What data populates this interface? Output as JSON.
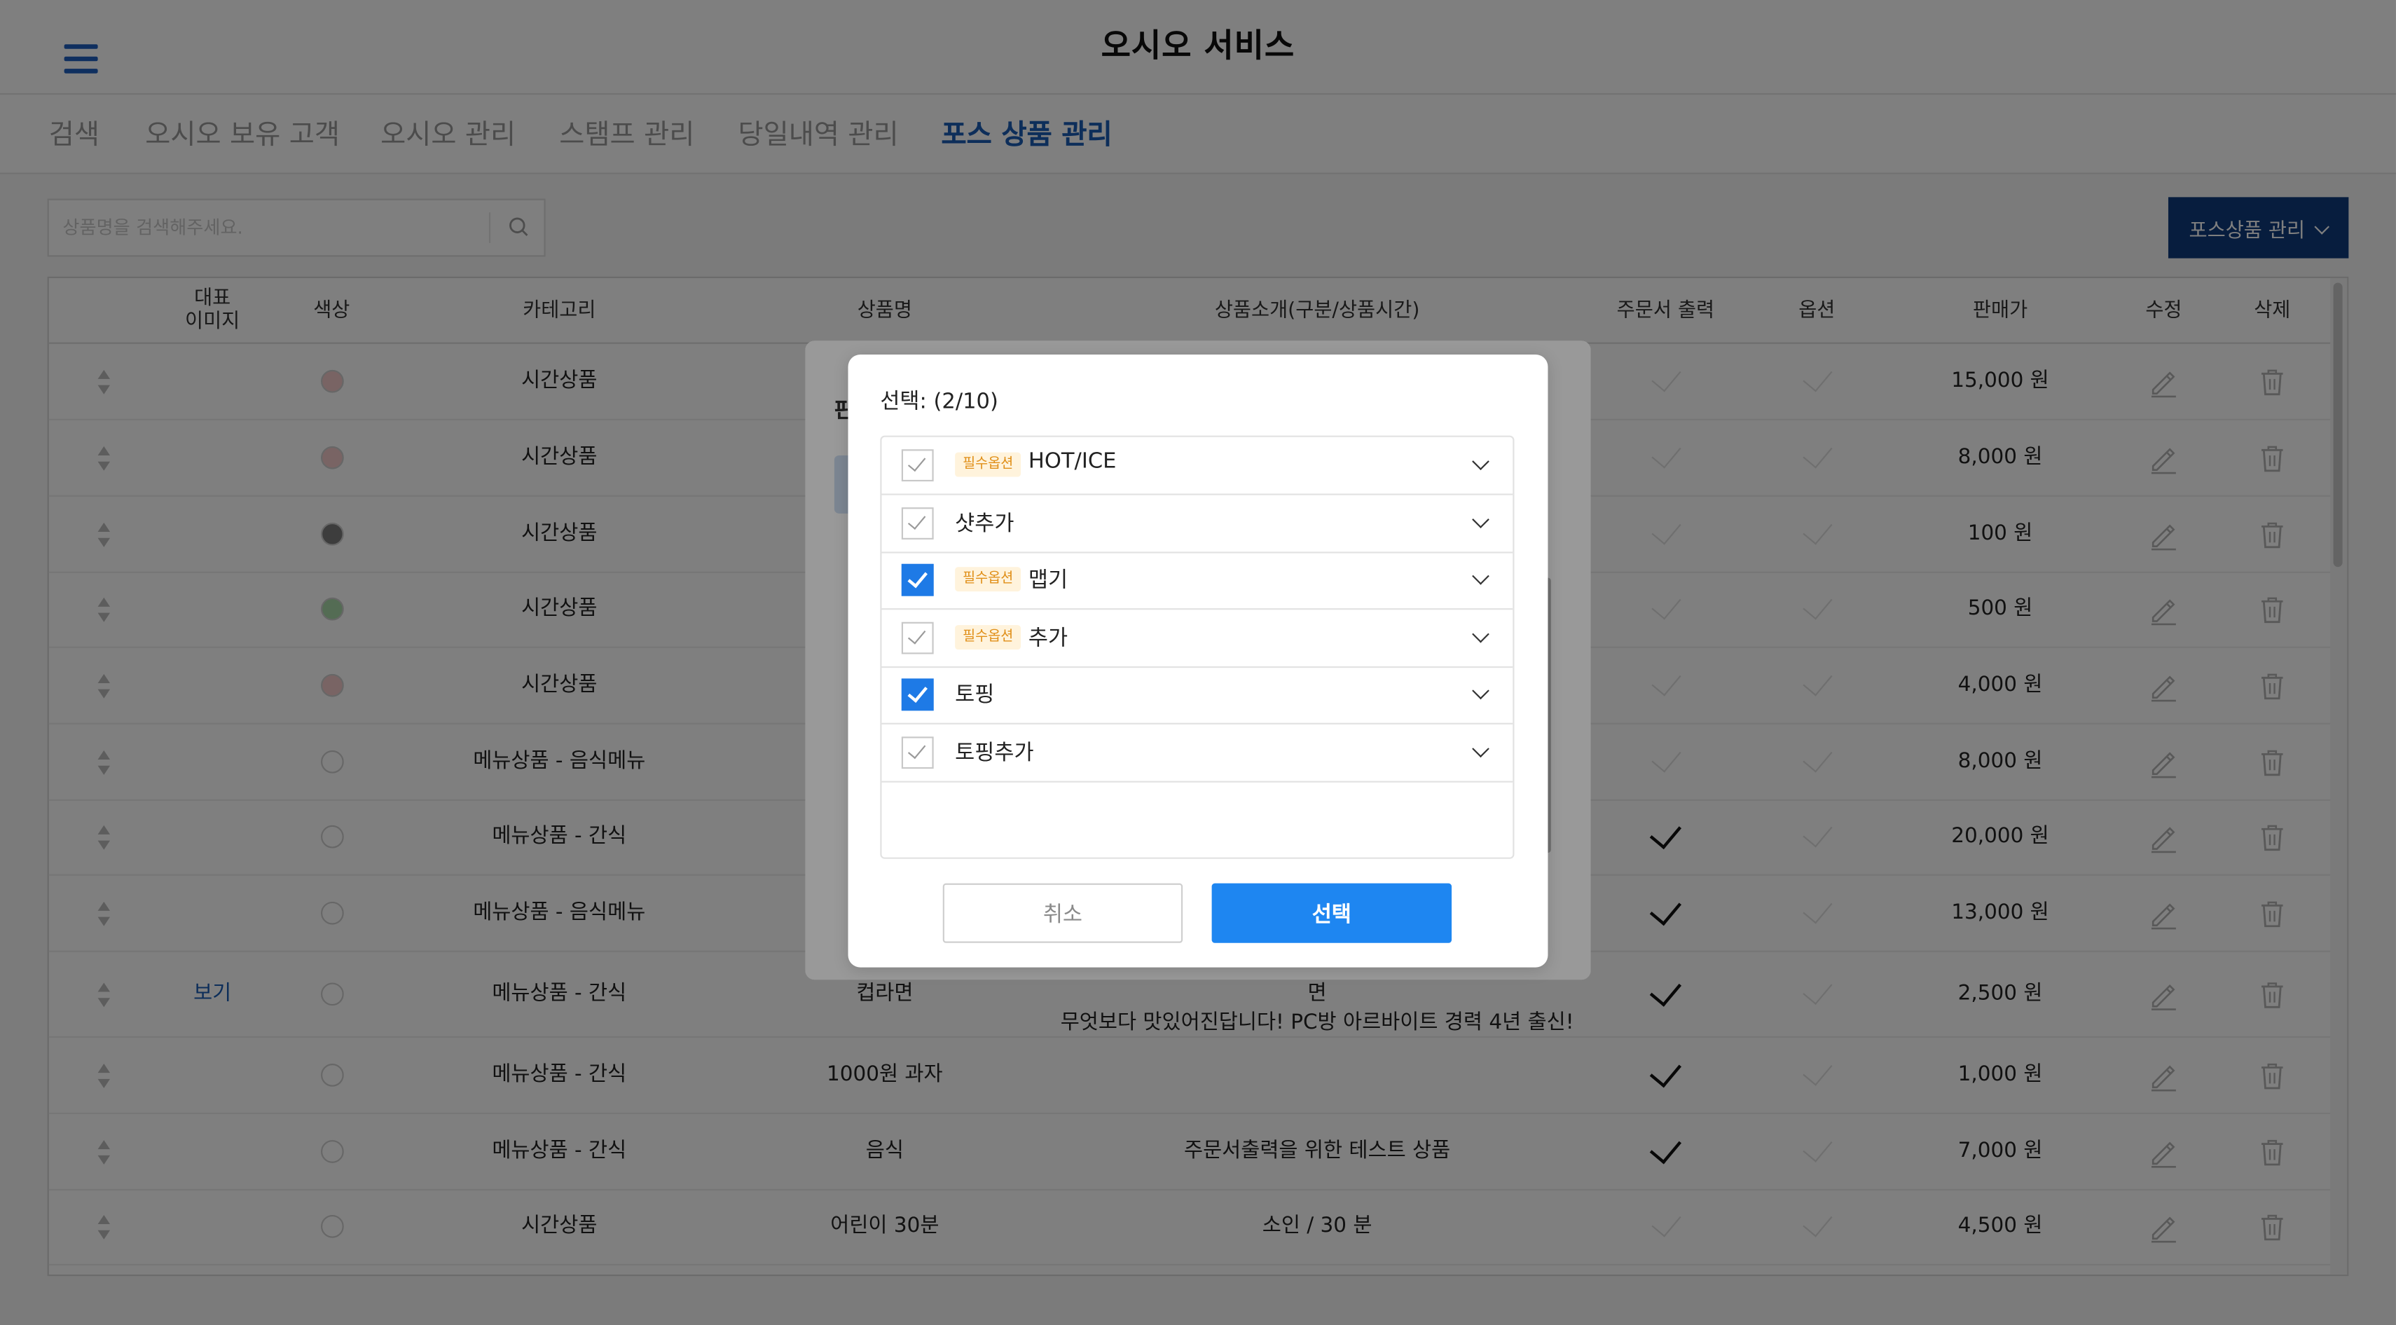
{
  "header": {
    "title": "오시오 서비스",
    "menu_icon": "hamburger-icon"
  },
  "tabs": [
    {
      "label": "검색"
    },
    {
      "label": "오시오 보유 고객"
    },
    {
      "label": "오시오 관리"
    },
    {
      "label": "스탬프 관리"
    },
    {
      "label": "당일내역 관리"
    },
    {
      "label": "포스 상품 관리",
      "active": true
    }
  ],
  "toolbar": {
    "search_placeholder": "상품명을 검색해주세요.",
    "search_icon": "search-icon",
    "pos_button_label": "포스상품 관리"
  },
  "table": {
    "columns": {
      "image_line1": "대표",
      "image_line2": "이미지",
      "color": "색상",
      "category": "카테고리",
      "name": "상품명",
      "description": "상품소개(구분/상품시간)",
      "print": "주문서 출력",
      "option": "옵션",
      "price": "판매가",
      "edit": "수정",
      "delete": "삭제"
    },
    "rows": [
      {
        "image": "",
        "color": "#f2c9c9",
        "category": "시간상품",
        "name": "",
        "desc1": "",
        "desc2": "",
        "print": false,
        "price": "15,000 원"
      },
      {
        "image": "",
        "color": "#f2c9c9",
        "category": "시간상품",
        "name": "",
        "desc1": "",
        "desc2": "",
        "print": false,
        "price": "8,000 원"
      },
      {
        "image": "",
        "color": "#7b7b7b",
        "category": "시간상품",
        "name": "",
        "desc1": "",
        "desc2": "",
        "print": false,
        "price": "100 원"
      },
      {
        "image": "",
        "color": "#a8d8a8",
        "category": "시간상품",
        "name": "",
        "desc1": "",
        "desc2": "",
        "print": false,
        "price": "500 원"
      },
      {
        "image": "",
        "color": "#f2c9c9",
        "category": "시간상품",
        "name": "",
        "desc1": "",
        "desc2": "",
        "print": false,
        "price": "4,000 원"
      },
      {
        "image": "",
        "color": "#ffffff",
        "category": "메뉴상품 - 음식메뉴",
        "name": "",
        "desc1": "",
        "desc2": "",
        "print": false,
        "price": "8,000 원"
      },
      {
        "image": "",
        "color": "#ffffff",
        "category": "메뉴상품 - 간식",
        "name": "",
        "desc1": "",
        "desc2": "",
        "print": true,
        "price": "20,000 원"
      },
      {
        "image": "",
        "color": "#ffffff",
        "category": "메뉴상품 - 음식메뉴",
        "name": "",
        "desc1": "",
        "desc2": "",
        "print": true,
        "price": "13,000 원"
      },
      {
        "image": "보기",
        "color": "#ffffff",
        "category": "메뉴상품 - 간식",
        "name": "컵라면",
        "desc1": "너구리 참깨라면 불닭볶음면 무엇이든 전자레인지와 함께라면",
        "desc2": "무엇보다 맛있어진답니다! PC방 아르바이트 경력 4년 출신!",
        "print": true,
        "price": "2,500 원"
      },
      {
        "image": "",
        "color": "#ffffff",
        "category": "메뉴상품 - 간식",
        "name": "1000원 과자",
        "desc1": "",
        "desc2": "",
        "print": true,
        "price": "1,000 원"
      },
      {
        "image": "",
        "color": "#ffffff",
        "category": "메뉴상품 - 간식",
        "name": "음식",
        "desc1": "주문서출력을 위한 테스트 상품",
        "desc2": "",
        "print": true,
        "price": "7,000 원"
      },
      {
        "image": "",
        "color": "#ffffff",
        "category": "시간상품",
        "name": "어린이 30분",
        "desc1": "소인 / 30 분",
        "desc2": "",
        "print": false,
        "price": "4,500 원"
      }
    ]
  },
  "back_dialog": {
    "title_fragment": "판"
  },
  "modal": {
    "title": "선택: (2/10)",
    "badge_label": "필수옵션",
    "options": [
      {
        "label": "HOT/ICE",
        "required": true,
        "checked": false
      },
      {
        "label": "샷추가",
        "required": false,
        "checked": false
      },
      {
        "label": "맵기",
        "required": true,
        "checked": true
      },
      {
        "label": "추가",
        "required": true,
        "checked": false
      },
      {
        "label": "토핑",
        "required": false,
        "checked": true
      },
      {
        "label": "토핑추가",
        "required": false,
        "checked": false
      }
    ],
    "cancel_label": "취소",
    "select_label": "선택"
  },
  "colors": {
    "accent": "#1e86f1",
    "brand_dark": "#0f3a7d",
    "tab_active": "#1a5db4",
    "badge_text": "#e08f18"
  }
}
